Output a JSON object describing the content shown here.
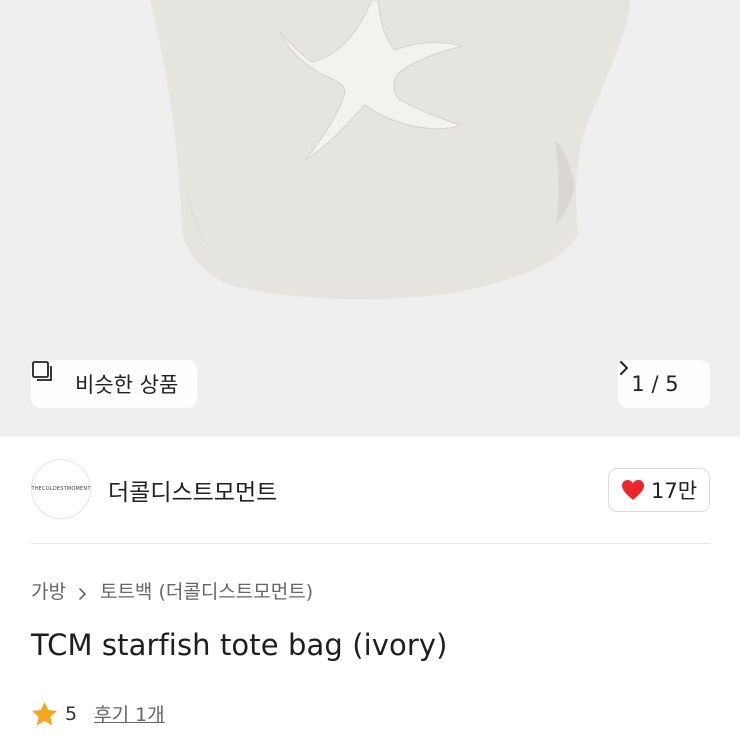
{
  "gallery": {
    "similar_label": "비슷한 상품",
    "counter": "1 / 5"
  },
  "shop": {
    "name": "더콜디스트모먼트",
    "avatar_text": "THECOLDESTMOMENT",
    "like_count": "17만",
    "heart_color": "#e8282b"
  },
  "breadcrumb": {
    "category": "가방",
    "subcategory": "토트백 (더콜디스트모먼트)"
  },
  "product": {
    "title": "TCM starfish tote bag (ivory)",
    "rating": "5",
    "review_link": "후기 1개",
    "star_color": "#f5a623"
  },
  "icons": {
    "similar": "similar-products-icon",
    "next": "chevron-right-icon",
    "heart": "heart-icon",
    "breadcrumb_sep": "chevron-right-icon",
    "star": "star-icon"
  }
}
